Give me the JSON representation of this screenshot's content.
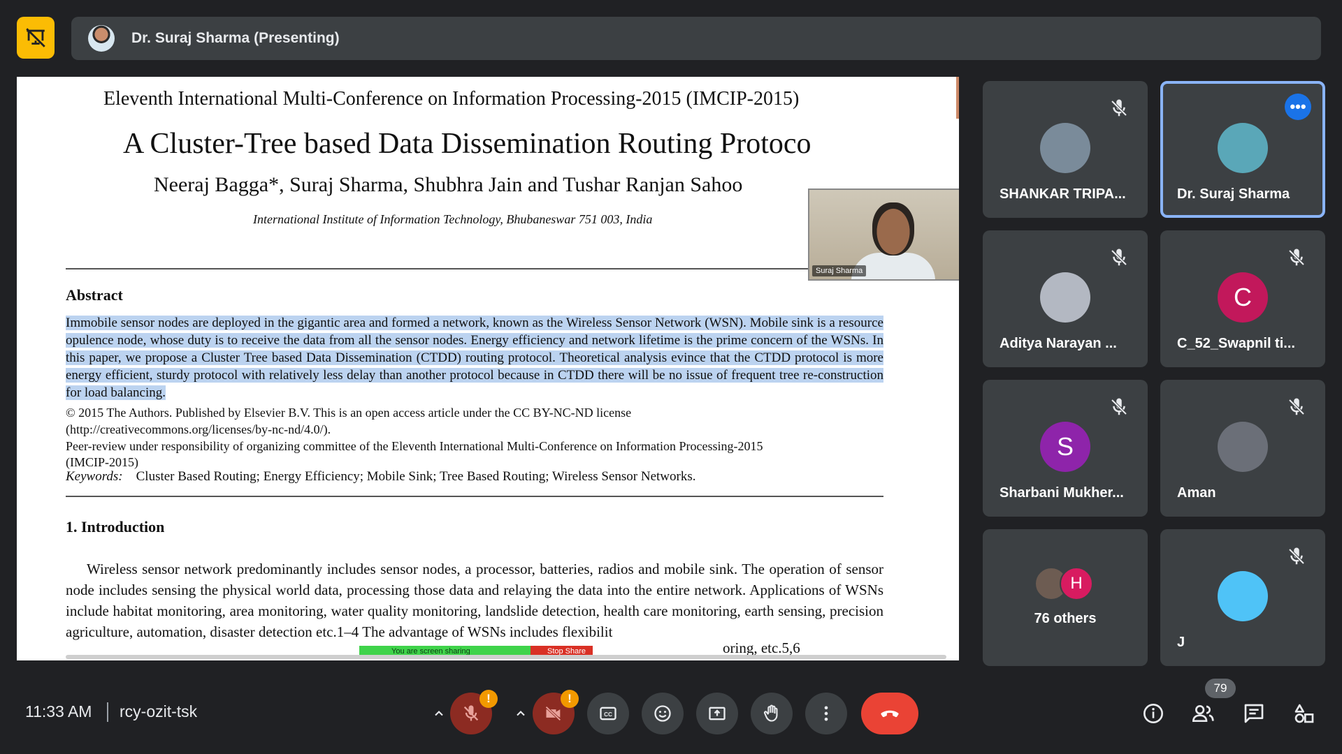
{
  "header": {
    "presenter_label": "Dr. Suraj Sharma (Presenting)"
  },
  "shared_document": {
    "conference": "Eleventh International Multi-Conference on Information Processing-2015 (IMCIP-2015)",
    "title": "A Cluster-Tree based Data Dissemination Routing Protoco",
    "authors": "Neeraj Bagga*, Suraj Sharma, Shubhra Jain and Tushar Ranjan Sahoo",
    "affiliation": "International Institute of Information Technology, Bhubaneswar 751 003, India",
    "abstract_heading": "Abstract",
    "abstract_text": "Immobile sensor nodes are deployed in the gigantic area and formed a network, known as the Wireless Sensor Network (WSN). Mobile sink is a resource opulence node, whose duty is to receive the data from all the sensor nodes. Energy efficiency and network lifetime is the prime concern of the WSNs. In this paper, we propose a Cluster Tree based Data Dissemination (CTDD) routing protocol. Theoretical analysis evince that the CTDD protocol is more energy efficient, sturdy protocol with relatively less delay than another protocol because in CTDD there will be no issue of frequent tree re-construction for load balancing.",
    "copyright_line": "© 2015 The Authors. Published by Elsevier B.V. This is an open access article under the CC BY-NC-ND license",
    "license_url": "(http://creativecommons.org/licenses/by-nc-nd/4.0/).",
    "peer_review": "Peer-review under responsibility of organizing committee of the Eleventh International Multi-Conference on Information Processing-2015 (IMCIP-2015)",
    "keywords_label": "Keywords:",
    "keywords": "Cluster Based Routing; Energy Efficiency; Mobile Sink; Tree Based Routing; Wireless Sensor Networks.",
    "intro_heading": "1.  Introduction",
    "intro_text": "Wireless sensor network predominantly includes sensor nodes, a processor, batteries, radios and mobile sink. The operation of sensor node includes sensing the physical world data, processing those data and relaying the data into the entire network. Applications of WSNs include habitat monitoring, area monitoring, water quality monitoring, landslide detection, health care monitoring, earth sensing, precision agriculture, automation, disaster detection etc.1–4 The advantage of WSNs includes flexibilit",
    "intro_tail": "oring, etc.5,6",
    "pip_label": "Suraj Sharma",
    "share_banner_text": "You are screen sharing",
    "stop_share_label": "Stop Share"
  },
  "participants": [
    {
      "name": "SHANKAR TRIPA...",
      "muted": true
    },
    {
      "name": "Dr. Suraj Sharma",
      "muted": false,
      "active": true
    },
    {
      "name": "Aditya Narayan ...",
      "muted": true
    },
    {
      "name": "C_52_Swapnil ti...",
      "muted": true,
      "initial": "C",
      "color": "#c2185b"
    },
    {
      "name": "Sharbani Mukher...",
      "muted": true,
      "initial": "S",
      "color": "#8e24aa"
    },
    {
      "name": "Aman",
      "muted": true
    },
    {
      "name": "76 others",
      "initial": "H",
      "color": "#d81b60"
    },
    {
      "name": "J",
      "muted": true
    }
  ],
  "footer": {
    "time": "11:33 AM",
    "meeting_code": "rcy-ozit-tsk",
    "participant_count": "79"
  },
  "colors": {
    "accent": "#8ab4f8",
    "hangup": "#ea4335",
    "warning": "#f29900",
    "presenting_icon_bg": "#fbbc04"
  }
}
